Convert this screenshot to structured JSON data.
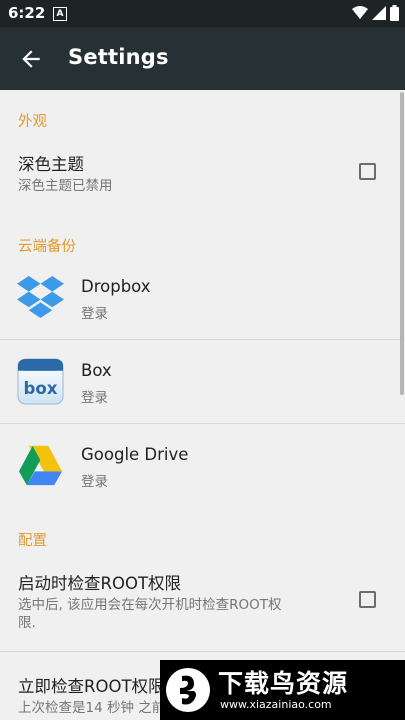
{
  "status_bar": {
    "time": "6:22",
    "notification_icon": "A"
  },
  "toolbar": {
    "title": "Settings"
  },
  "sections": {
    "appearance": {
      "header": "外观",
      "dark_theme": {
        "title": "深色主题",
        "summary": "深色主题已禁用",
        "checked": false
      }
    },
    "cloud_backup": {
      "header": "云端备份",
      "items": [
        {
          "title": "Dropbox",
          "summary": "登录",
          "icon": "dropbox-icon"
        },
        {
          "title": "Box",
          "summary": "登录",
          "icon": "box-icon",
          "icon_text": "box"
        },
        {
          "title": "Google Drive",
          "summary": "登录",
          "icon": "google-drive-icon"
        }
      ]
    },
    "config": {
      "header": "配置",
      "root_check_on_start": {
        "title": "启动时检查ROOT权限",
        "summary_line1": "选中后, 该应用会在每次开机时检查ROOT权",
        "summary_line2": "限.",
        "checked": false
      },
      "root_check_now": {
        "title": "立即检查ROOT权限",
        "summary": "上次检查是14 秒钟 之前"
      }
    }
  },
  "watermark": {
    "text": "下载鸟资源",
    "url": "www.xiazainiao.com"
  },
  "colors": {
    "accent": "#e39a2f",
    "toolbar": "#263035",
    "status_bar": "#1e2426"
  }
}
